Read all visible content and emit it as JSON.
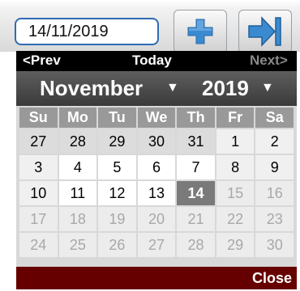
{
  "date_field": {
    "value": "14/11/2019"
  },
  "toolbar": {
    "add_icon": "plus-icon",
    "next_icon": "arrow-to-end-icon"
  },
  "calendar": {
    "prev_label": "<Prev",
    "today_label": "Today",
    "next_label": "Next>",
    "month_label": "November",
    "year_label": "2019",
    "dropdown_arrow": "▼",
    "weekdays": [
      "Su",
      "Mo",
      "Tu",
      "We",
      "Th",
      "Fr",
      "Sa"
    ],
    "weeks": [
      [
        "27",
        "28",
        "29",
        "30",
        "31",
        "1",
        "2"
      ],
      [
        "3",
        "4",
        "5",
        "6",
        "7",
        "8",
        "9"
      ],
      [
        "10",
        "11",
        "12",
        "13",
        "14",
        "15",
        "16"
      ],
      [
        "17",
        "18",
        "19",
        "20",
        "21",
        "22",
        "23"
      ],
      [
        "24",
        "25",
        "26",
        "27",
        "28",
        "29",
        "30"
      ]
    ],
    "selected_day": "14",
    "close_label": "Close",
    "colors": {
      "header": "#000000",
      "month_bar": "#4a4a4a",
      "weekday_bg": "#999999",
      "selected": "#7a7a7a",
      "footer": "#660000",
      "input_border": "#2f6bb3",
      "icon_blue": "#3a8ad0"
    }
  }
}
